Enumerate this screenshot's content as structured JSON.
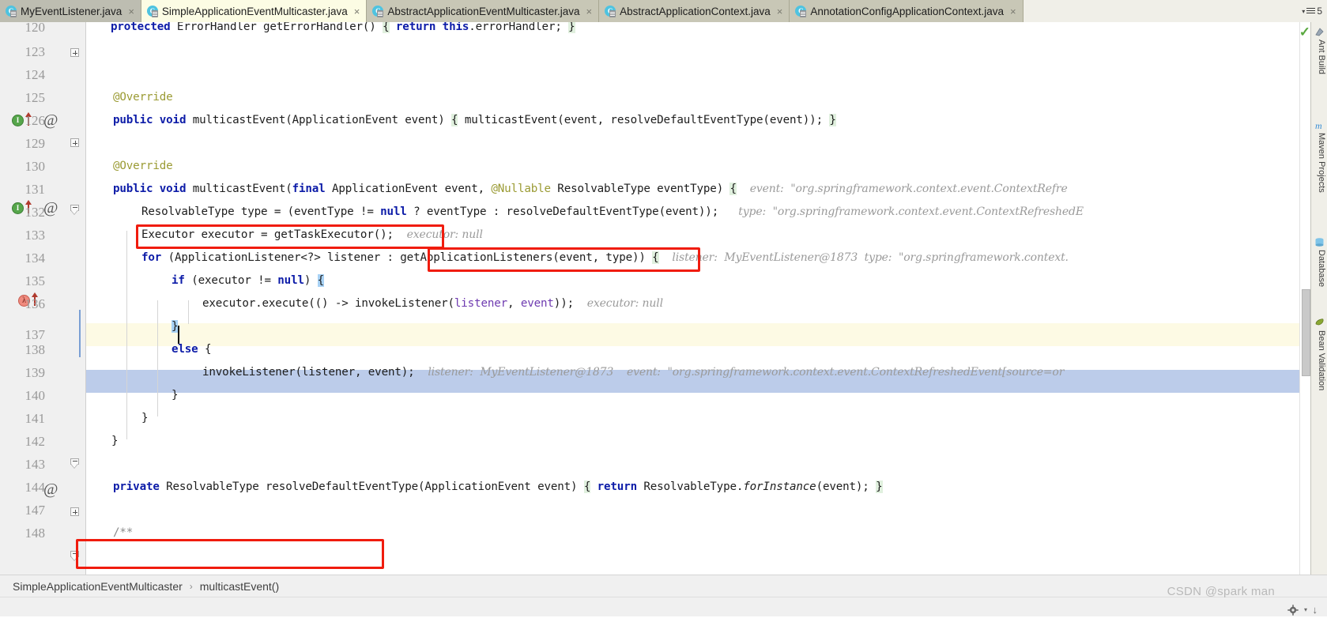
{
  "window": {
    "app": "IntelliJ IDEA Editor",
    "watermark": "CSDN @spark man"
  },
  "tabs": {
    "items": [
      {
        "label": "MyEventListener.java",
        "icon": "java-class-icon",
        "state": "inactive",
        "close": "×"
      },
      {
        "label": "SimpleApplicationEventMulticaster.java",
        "icon": "java-class-icon",
        "state": "active",
        "close": "×"
      },
      {
        "label": "AbstractApplicationEventMulticaster.java",
        "icon": "java-class-icon",
        "state": "inactive",
        "close": "×"
      },
      {
        "label": "AbstractApplicationContext.java",
        "icon": "java-class-icon",
        "state": "inactive",
        "close": "×"
      },
      {
        "label": "AnnotationConfigApplicationContext.java",
        "icon": "java-class-icon",
        "state": "inactive",
        "close": "×"
      }
    ],
    "overflow_count": "5",
    "overflow_caret": "▾",
    "class_icon_letter": "C"
  },
  "editor": {
    "lines": [
      {
        "num": "120",
        "text": ""
      },
      {
        "num": "123",
        "text": ""
      },
      {
        "num": "124",
        "text": ""
      },
      {
        "num": "125",
        "text": "@Override"
      },
      {
        "num": "126",
        "text": "public void multicastEvent(ApplicationEvent event) { multicastEvent(event, resolveDefaultEventType(event)); }"
      },
      {
        "num": "129",
        "text": ""
      },
      {
        "num": "130",
        "text": "@Override"
      },
      {
        "num": "131",
        "text": "public void multicastEvent(final ApplicationEvent event, @Nullable ResolvableType eventType) {"
      },
      {
        "num": "132",
        "text": "ResolvableType type = (eventType != null ? eventType : resolveDefaultEventType(event));"
      },
      {
        "num": "133",
        "text": "Executor executor = getTaskExecutor();"
      },
      {
        "num": "134",
        "text": "for (ApplicationListener<?> listener : getApplicationListeners(event, type)) {"
      },
      {
        "num": "135",
        "text": "if (executor != null) {"
      },
      {
        "num": "136",
        "text": "executor.execute(() -> invokeListener(listener, event));"
      },
      {
        "num": "137",
        "text": "}"
      },
      {
        "num": "138",
        "text": "else {"
      },
      {
        "num": "139",
        "text": "invokeListener(listener, event);"
      },
      {
        "num": "140",
        "text": "}"
      },
      {
        "num": "141",
        "text": "}"
      },
      {
        "num": "142",
        "text": "}"
      },
      {
        "num": "143",
        "text": ""
      },
      {
        "num": "144",
        "text": "private ResolvableType resolveDefaultEventType(ApplicationEvent event) { return ResolvableType.forInstance(event); }"
      },
      {
        "num": "147",
        "text": ""
      },
      {
        "num": "148",
        "text": "/**"
      }
    ],
    "line_120_text": "protected ErrorHandler getErrorHandler() { return this.errorHandler; }",
    "hints": {
      "line_131": "event:  \"org.springframework.context.event.ContextRefre",
      "line_132": "type:  \"org.springframework.context.event.ContextRefreshedE",
      "line_133": "executor: null",
      "line_134_listener": "listener:  MyEventListener@1873",
      "line_134_type": "type:  \"org.springframework.context.",
      "line_136": "executor: null",
      "line_139_listener": "listener:  MyEventListener@1873",
      "line_139_event": "event:  \"org.springframework.context.event.ContextRefreshedEvent[source=or"
    },
    "gutter_icons": {
      "line_126": [
        "implemented-method-icon",
        "override-arrow-icon",
        "at-annotation-icon"
      ],
      "line_131": [
        "implemented-method-icon",
        "override-arrow-icon",
        "at-annotation-icon"
      ],
      "line_136": [
        "lambda-icon",
        "override-arrow-icon"
      ],
      "line_144": [
        "at-annotation-icon"
      ]
    },
    "inspection_status": "✓"
  },
  "annotations": {
    "box_1_target": "Executor executor = getTaskExecutor();",
    "box_2_target": "getApplicationListeners(event, type)",
    "box_3_target": "breadcrumb",
    "color": "#f01c0e"
  },
  "breadcrumb": {
    "items": [
      "SimpleApplicationEventMulticaster",
      "multicastEvent()"
    ],
    "separator": "›"
  },
  "right_toolbar": {
    "items": [
      {
        "label": "Ant Build",
        "icon": "ant-build-icon"
      },
      {
        "label": "Maven Projects",
        "icon": "maven-icon"
      },
      {
        "label": "Database",
        "icon": "database-icon"
      },
      {
        "label": "Bean Validation",
        "icon": "bean-validation-icon"
      }
    ]
  },
  "colors": {
    "tab_active_bg": "#fcfce4",
    "tab_bg": "#c8c7b6",
    "exec_line_bg": "#bcccea",
    "caret_line_bg": "#fdfae4",
    "keyword": "#0d1ca8",
    "annotation": "#9b9b34",
    "hint": "#9a9a9a"
  }
}
